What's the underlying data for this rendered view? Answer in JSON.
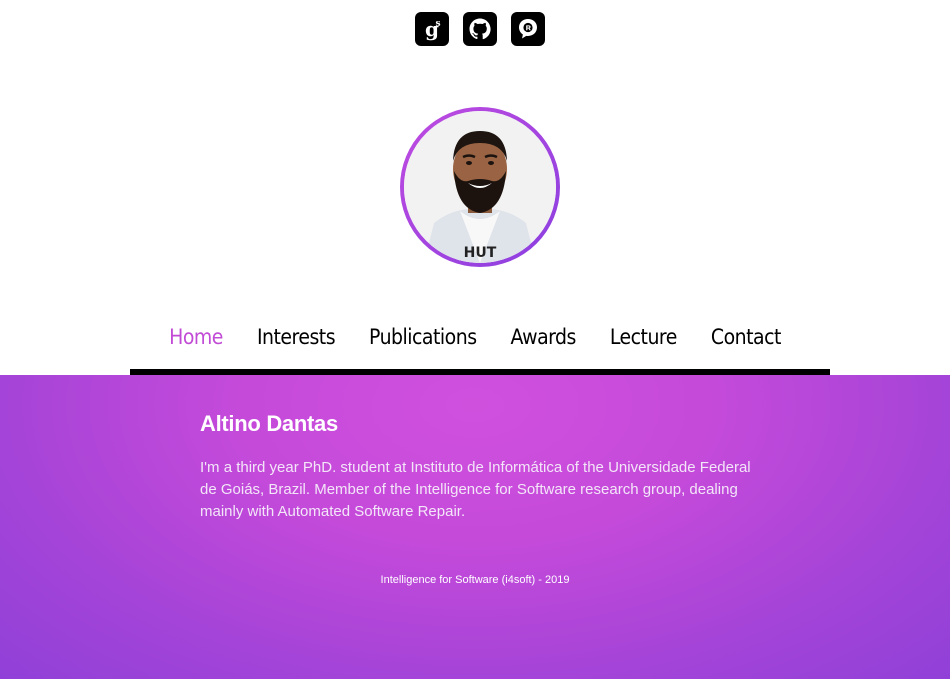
{
  "social": [
    {
      "icon": "google-scholar-icon"
    },
    {
      "icon": "github-icon"
    },
    {
      "icon": "researchgate-icon"
    }
  ],
  "nav": {
    "items": [
      "Home",
      "Interests",
      "Publications",
      "Awards",
      "Lecture",
      "Contact"
    ],
    "active": "Home",
    "active_color": "#c24bd6"
  },
  "profile": {
    "name": "Altino Dantas",
    "bio": "I'm a third year PhD. student at Instituto de Informática of the Universidade Federal de Goiás, Brazil. Member of the Intelligence for Software research group, dealing mainly with Automated Software Repair."
  },
  "footer": {
    "text": "Intelligence for Software (i4soft) - 2019"
  },
  "colors": {
    "hero_gradient_start": "#d050de",
    "hero_gradient_end": "#9040d8",
    "avatar_ring": "#b048e0"
  }
}
